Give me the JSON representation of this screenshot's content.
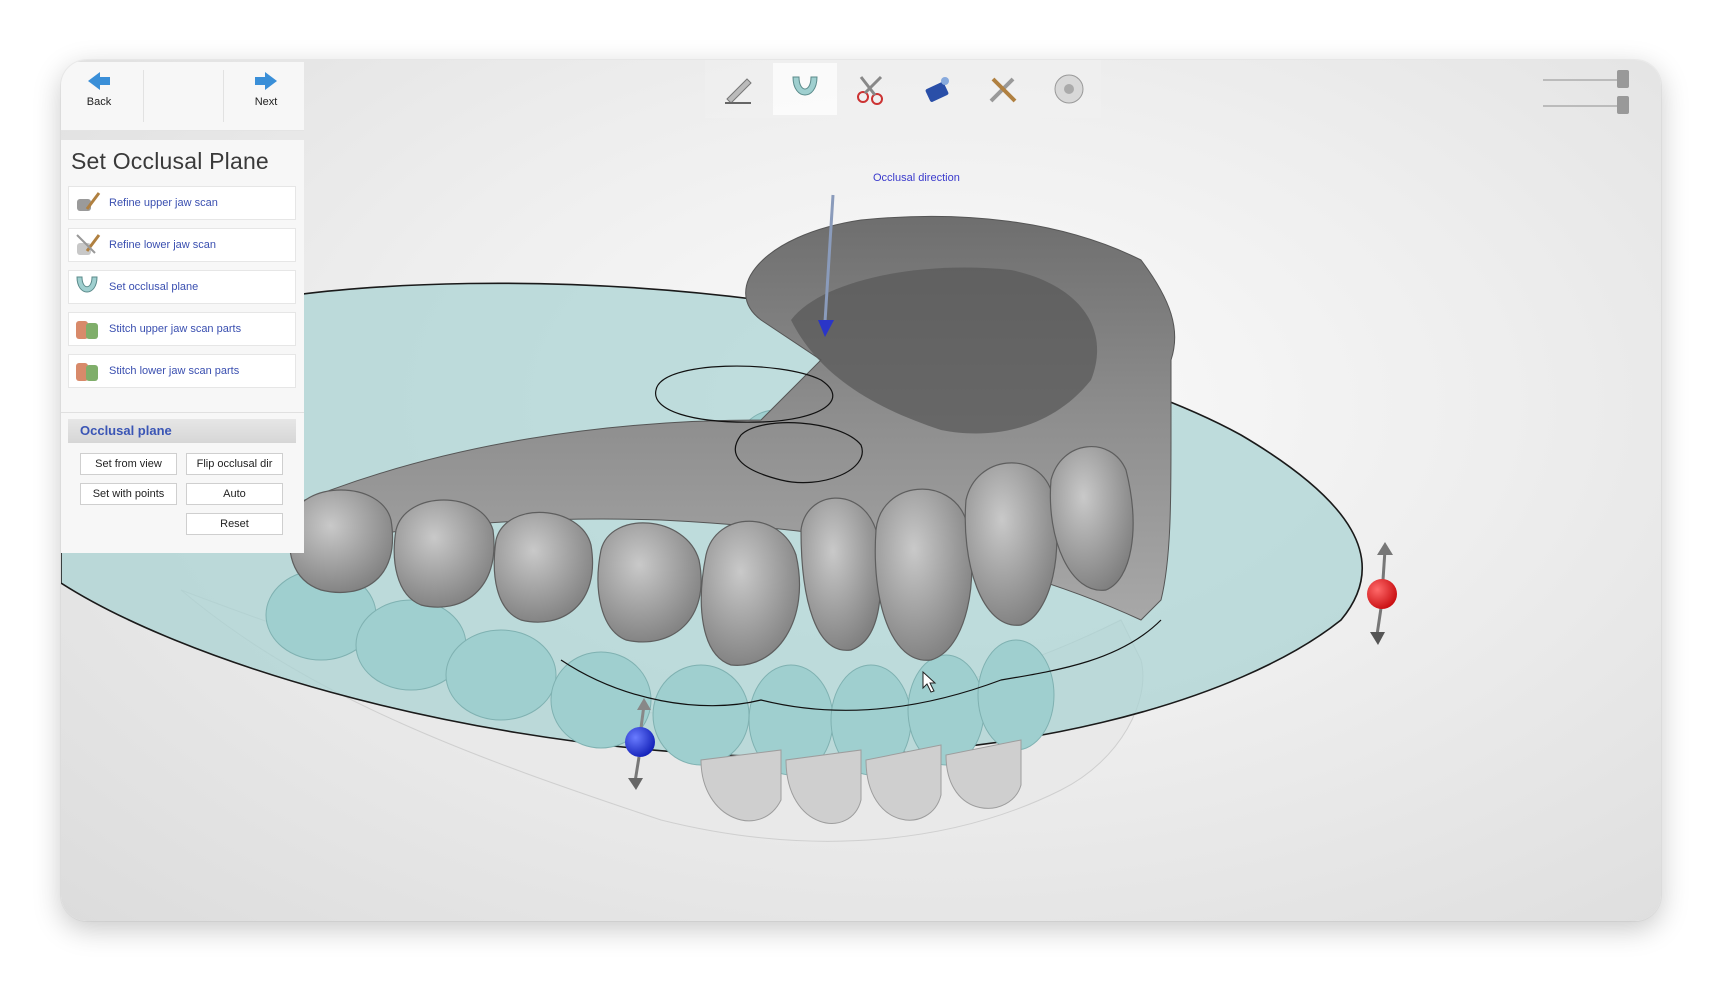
{
  "nav": {
    "back_label": "Back",
    "next_label": "Next"
  },
  "step": {
    "title": "Set Occlusal Plane",
    "items": [
      {
        "label": "Refine upper jaw scan",
        "icon": "refine-upper-icon"
      },
      {
        "label": "Refine lower jaw scan",
        "icon": "refine-lower-icon"
      },
      {
        "label": "Set occlusal plane",
        "icon": "occlusal-plane-icon"
      },
      {
        "label": "Stitch upper jaw scan parts",
        "icon": "stitch-upper-icon"
      },
      {
        "label": "Stitch lower jaw scan parts",
        "icon": "stitch-lower-icon"
      }
    ]
  },
  "occlusal": {
    "header": "Occlusal plane",
    "buttons": {
      "set_from_view": "Set from view",
      "flip": "Flip occlusal dir",
      "set_with_points": "Set with points",
      "auto": "Auto",
      "reset": "Reset"
    }
  },
  "viewport": {
    "direction_label": "Occlusal direction"
  },
  "toolbar": {
    "tools": [
      "pen-icon",
      "arch-icon",
      "scissors-icon",
      "scanner-icon",
      "tools-icon",
      "disc-icon"
    ]
  },
  "colors": {
    "accent": "#3a55b5",
    "plane": "#a9d3d3",
    "handle_red": "#e0191b",
    "handle_blue": "#1a2fd6"
  }
}
